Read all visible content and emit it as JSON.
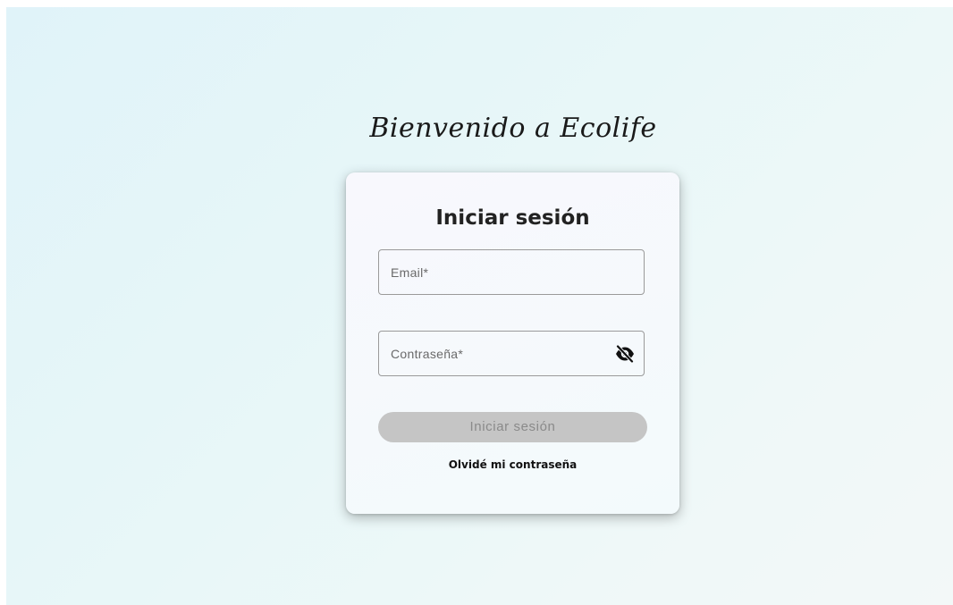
{
  "header": {
    "welcome_text": "Bienvenido a Ecolife"
  },
  "login_card": {
    "title": "Iniciar sesión",
    "email_placeholder": "Email*",
    "email_value": "",
    "password_placeholder": "Contraseña*",
    "password_value": "",
    "password_visibility_icon": "eye-off-icon",
    "submit_label": "Iniciar sesión",
    "submit_state": "disabled",
    "forgot_password_label": "Olvidé mi contraseña"
  },
  "colors": {
    "background_start": "#e0f3f9",
    "background_end": "#f3f8f8",
    "card_background": "#f6f9fc",
    "button_disabled_bg": "#c5c5c5",
    "button_disabled_text": "#8a8a8a",
    "field_border": "#9a9a9a"
  }
}
